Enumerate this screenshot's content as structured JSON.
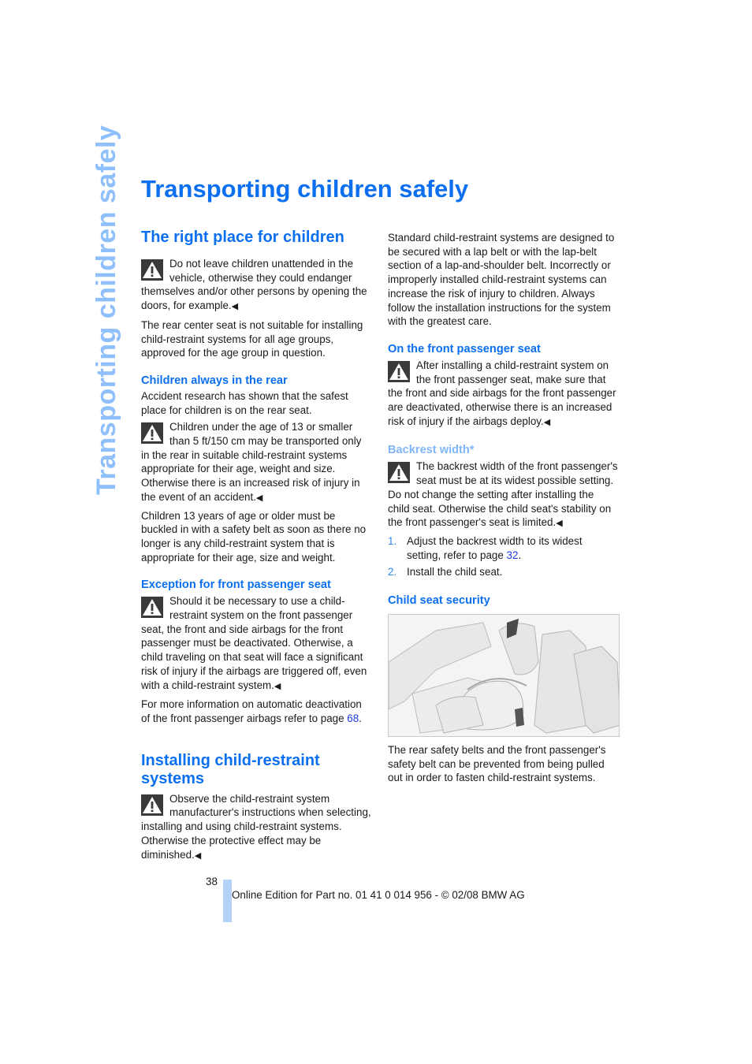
{
  "side_title": "Transporting children safely",
  "page_title": "Transporting children safely",
  "left_column": {
    "right_place": {
      "heading": "The right place for children",
      "warning": "Do not leave children unattended in the vehicle, otherwise they could endanger themselves and/or other persons by opening the doors, for example.",
      "paragraph": "The rear center seat is not suitable for installing child-restraint systems for all age groups, approved for the age group in question."
    },
    "always_rear": {
      "heading": "Children always in the rear",
      "paragraph1": "Accident research has shown that the safest place for children is on the rear seat.",
      "warning": "Children under the age of 13 or smaller than 5 ft/150 cm may be transported only in the rear in suitable child-restraint systems appropriate for their age, weight and size. Otherwise there is an increased risk of injury in the event of an accident.",
      "paragraph2": "Children 13 years of age or older must be buckled in with a safety belt as soon as there no longer is any child-restraint system that is appropriate for their age, size and weight."
    },
    "exception": {
      "heading": "Exception for front passenger seat",
      "warning": "Should it be necessary to use a child-restraint system on the front passenger seat, the front and side airbags for the front passenger must be deactivated. Otherwise, a child traveling on that seat will face a significant risk of injury if the airbags are triggered off, even with a child-restraint system.",
      "more_info_text": "For more information on automatic deactivation of the front passenger airbags refer to page ",
      "more_info_page": "68",
      "more_info_end": "."
    },
    "installing": {
      "heading": "Installing child-restraint systems",
      "warning": "Observe the child-restraint system manufacturer's instructions when selecting, installing and using child-restraint systems. Otherwise the protective effect may be diminished."
    }
  },
  "right_column": {
    "intro": "Standard child-restraint systems are designed to be secured with a lap belt or with the lap-belt section of a lap-and-shoulder belt. Incorrectly or improperly installed child-restraint systems can increase the risk of injury to children. Always follow the installation instructions for the system with the greatest care.",
    "front_passenger": {
      "heading": "On the front passenger seat",
      "warning": "After installing a child-restraint system on the front passenger seat, make sure that the front and side airbags for the front passenger are deactivated, otherwise there is an increased risk of injury if the airbags deploy."
    },
    "backrest": {
      "heading": "Backrest width*",
      "warning": "The backrest width of the front passenger's seat must be at its widest possible setting. Do not change the setting after installing the child seat. Otherwise the child seat's stability on the front passenger's seat is limited.",
      "steps": [
        {
          "num": "1.",
          "text": "Adjust the backrest width to its widest setting, refer to page ",
          "page": "32",
          "end": "."
        },
        {
          "num": "2.",
          "text": "Install the child seat."
        }
      ]
    },
    "security": {
      "heading": "Child seat security",
      "figure_alt": "Illustration of child seat installed on rear seat with safety belt",
      "paragraph": "The rear safety belts and the front passenger's safety belt can be prevented from being pulled out in order to fasten child-restraint systems."
    }
  },
  "end_mark": "◀",
  "footer": {
    "page_number": "38",
    "text": "Online Edition for Part no. 01 41 0 014 956 - © 02/08 BMW AG"
  },
  "colors": {
    "heading_blue": "#0b6ff0",
    "muted_blue": "#7fb6fb",
    "side_title": "#8fc0fb",
    "footer_bar": "#b3d3fb",
    "link": "#1a3ad8"
  }
}
